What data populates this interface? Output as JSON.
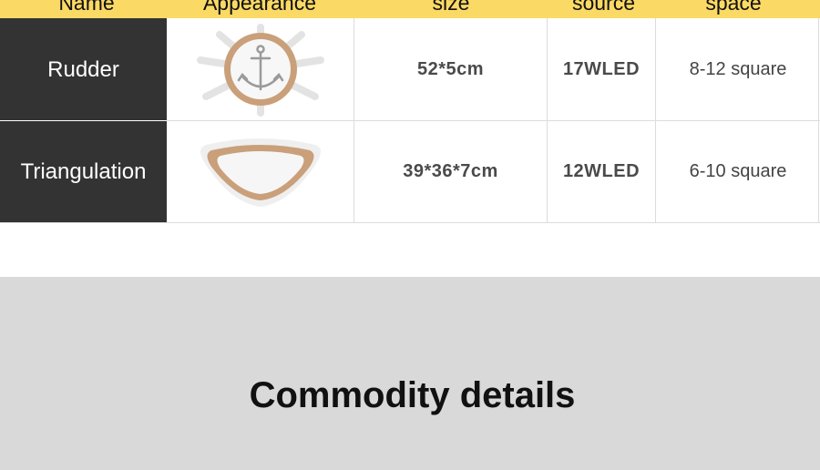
{
  "header": {
    "name": "Name",
    "appearance": "Appearance",
    "size": "size",
    "source": "source",
    "space": "space"
  },
  "rows": [
    {
      "name": "Rudder",
      "image_icon": "ship-wheel-lamp-icon",
      "size": "52*5cm",
      "source": "17WLED",
      "space": "8-12 square"
    },
    {
      "name": "Triangulation",
      "image_icon": "rounded-triangle-lamp-icon",
      "size": "39*36*7cm",
      "source": "12WLED",
      "space": "6-10 square"
    }
  ],
  "section": {
    "title": "Commodity details"
  },
  "colors": {
    "header_bg": "#fbd965",
    "name_bg": "#333333",
    "band_bg": "#d9d9d9",
    "wood": "#c9a07a"
  }
}
